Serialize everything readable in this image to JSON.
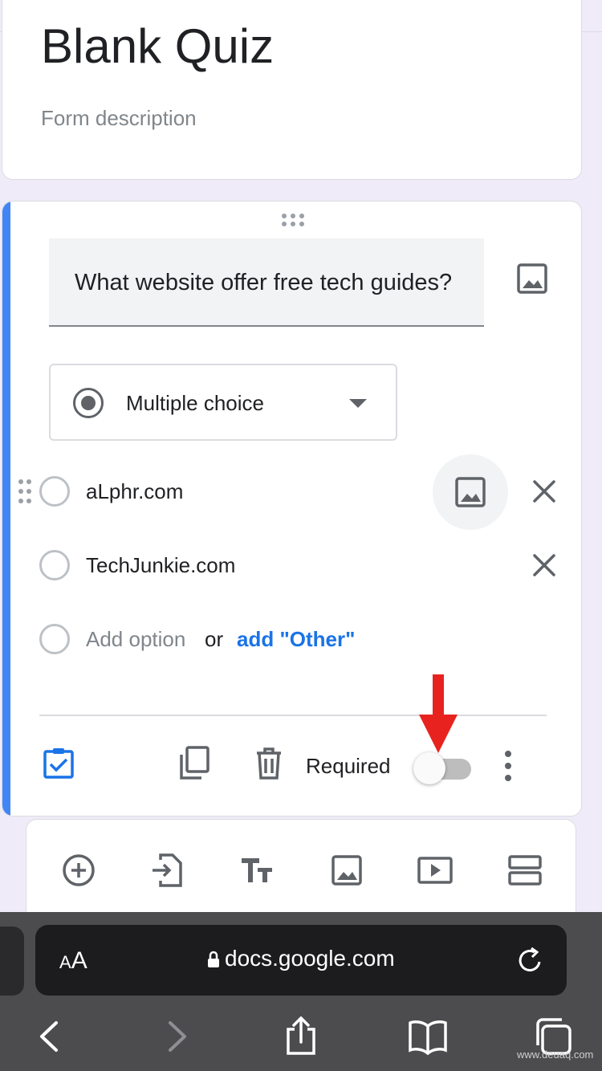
{
  "form": {
    "title": "Blank Quiz",
    "description_placeholder": "Form description"
  },
  "question": {
    "text": "What website offer free tech guides?",
    "type_label": "Multiple choice",
    "options": [
      {
        "label": "aLphr.com"
      },
      {
        "label": "TechJunkie.com"
      }
    ],
    "add_option_label": "Add option",
    "or_label": "or",
    "add_other_label": "add \"Other\"",
    "required_label": "Required",
    "required_value": false
  },
  "icons": {
    "drag_handle": "drag-handle-icon",
    "image": "image-icon",
    "radio": "radio-icon",
    "close": "close-icon",
    "answer_key": "answer-key-icon",
    "duplicate": "duplicate-icon",
    "delete": "trash-icon",
    "more": "more-vert-icon",
    "add_question": "add-circle-icon",
    "import_questions": "import-icon",
    "add_title": "title-text-icon",
    "add_image": "image-icon",
    "add_video": "video-icon",
    "add_section": "section-icon"
  },
  "browser": {
    "text_size_label_small": "A",
    "text_size_label_big": "A",
    "url": "docs.google.com"
  },
  "watermark": "www.deuaq.com",
  "colors": {
    "accent_blue": "#4285f4",
    "link_blue": "#1a73e8",
    "annotation_red": "#e8231f",
    "browser_bar": "#4c4c4e"
  }
}
